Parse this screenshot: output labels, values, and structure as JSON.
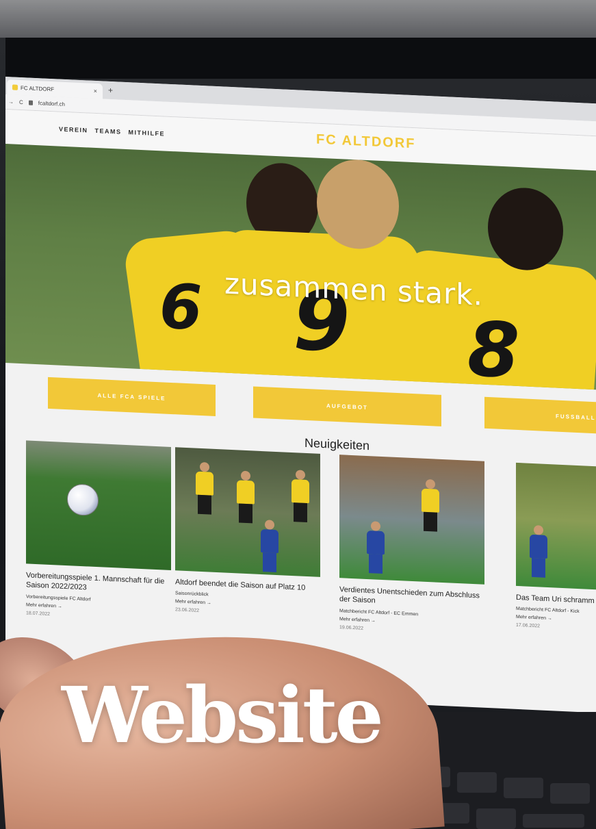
{
  "browser": {
    "tab_title": "FC ALTDORF",
    "tab_close": "×",
    "new_tab": "+",
    "url": "fcaltdorf.ch"
  },
  "site": {
    "nav": [
      "VEREIN",
      "TEAMS",
      "MITHILFE"
    ],
    "logo": "FC ALTDORF",
    "hero_text": "zusammen stark.",
    "jersey_numbers": [
      "6",
      "9",
      "8"
    ]
  },
  "buttons": [
    "ALLE FCA SPIELE",
    "AUFGEBOT",
    "FUSSBALLS"
  ],
  "news": {
    "heading": "Neuigkeiten",
    "more_label": "Mehr erfahren →",
    "items": [
      {
        "title": "Vorbereitungsspiele 1. Mannschaft für die Saison 2022/2023",
        "subtitle": "Vorbereitungsspiele FC Altdorf",
        "date": "18.07.2022"
      },
      {
        "title": "Altdorf beendet die Saison auf Platz 10",
        "subtitle": "Saisonrückblick",
        "date": "23.06.2022"
      },
      {
        "title": "Verdientes Unentschieden zum Abschluss der Saison",
        "subtitle": "Matchbericht FC Altdorf - EC Emmen",
        "date": "19.06.2022"
      },
      {
        "title": "Das Team Uri schramm",
        "subtitle": "Matchbericht FC Altdorf - Kick",
        "date": "17.06.2022"
      }
    ]
  },
  "overlay": {
    "word": "Website"
  },
  "colors": {
    "brand_yellow": "#f2c838",
    "page_bg": "#f2f2f2"
  }
}
